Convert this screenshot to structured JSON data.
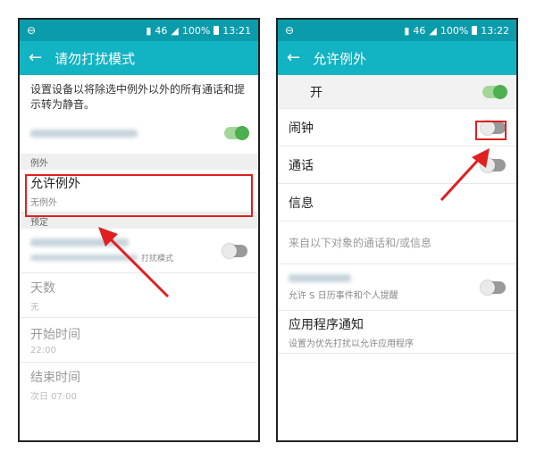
{
  "status_bar": {
    "signal_text": "46",
    "battery_text": "100%"
  },
  "left_screen": {
    "time": "13:21",
    "title": "请勿打扰模式",
    "description": "设置设备以将除选中例外以外的所有通话和提示转为静音。",
    "main_toggle_on": true,
    "section_exceptions": "例外",
    "allow_exceptions": {
      "title": "允许例外",
      "sub": "无例外"
    },
    "section_schedule": "预定",
    "scheduled_item_suffix": "打扰模式",
    "days": {
      "title": "天数",
      "sub": "无"
    },
    "start_time": {
      "title": "开始时间",
      "sub": "22:00"
    },
    "end_time": {
      "title": "结束时间",
      "sub": "次日 07:00"
    }
  },
  "right_screen": {
    "time": "13:22",
    "title": "允许例外",
    "master": {
      "label": "开",
      "on": true
    },
    "alarm": {
      "label": "闹钟",
      "on": false
    },
    "calls": {
      "label": "通话",
      "on": false
    },
    "messages": {
      "label": "信息"
    },
    "from_contacts": {
      "label": "来自以下对象的通话和/或信息"
    },
    "events": {
      "sub": "允许 S 日历事件和个人提醒",
      "on": false
    },
    "app_notifications": {
      "title": "应用程序通知",
      "sub": "设置为优先打扰以允许应用程序"
    }
  },
  "colors": {
    "status_bar": "#0b9cac",
    "app_bar": "#12b3c3",
    "toggle_on": "#4caf50",
    "highlight": "#e02020"
  },
  "icons": {
    "back": "arrow-left-icon",
    "status_left": "do-not-disturb-icon",
    "battery": "battery-icon"
  }
}
